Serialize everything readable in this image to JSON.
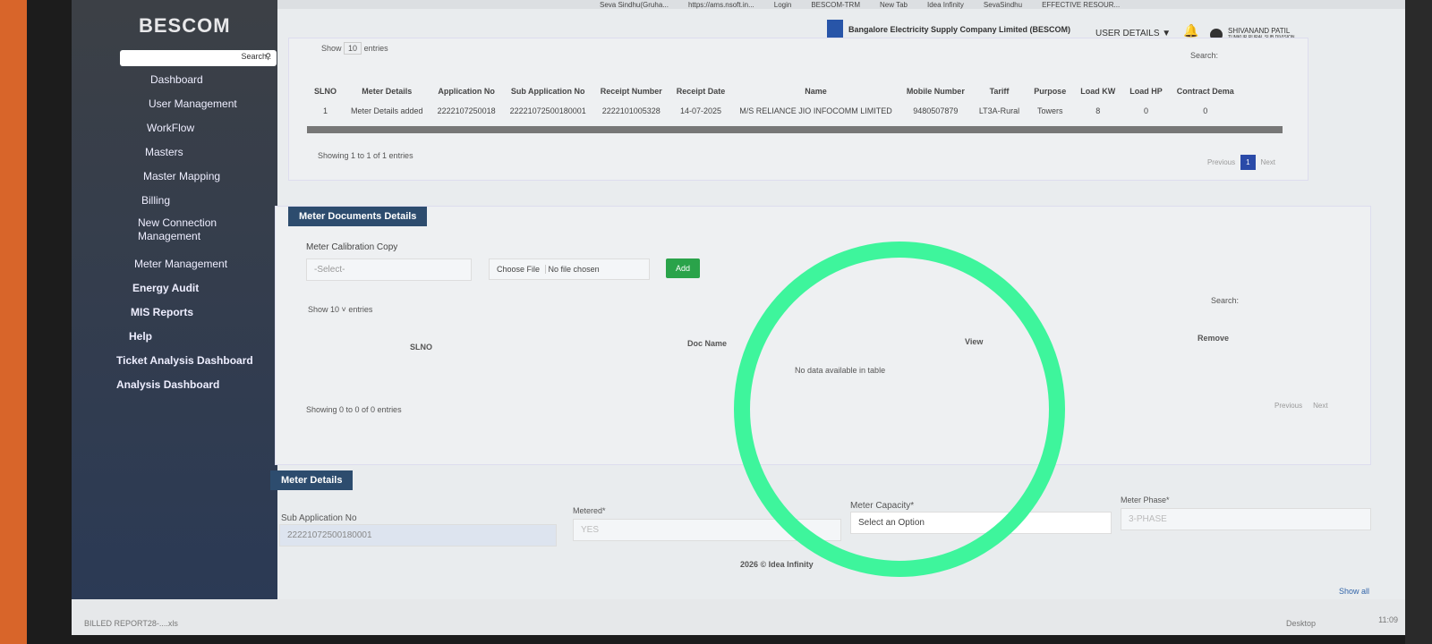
{
  "bookmarks": [
    "Seva Sindhu(Gruha...",
    "https://ams.nsoft.in...",
    "Login",
    "BESCOM-TRM",
    "New Tab",
    "Idea Infinity",
    "SevaSindhu",
    "EFFECTIVE RESOUR..."
  ],
  "sidebar": {
    "brand": "BESCOM",
    "search_placeholder": "Search..",
    "items": [
      "Dashboard",
      "User Management",
      "WorkFlow",
      "Masters",
      "Master Mapping",
      "Billing",
      "New Connection Management",
      "Meter Management",
      "Energy Audit",
      "MIS Reports",
      "Help",
      "Ticket Analysis Dashboard",
      "Analysis Dashboard"
    ]
  },
  "header": {
    "company": "Bangalore Electricity Supply Company Limited (BESCOM)",
    "user_details": "USER DETAILS",
    "user_name": "SHIVANAND PATIL",
    "user_division": "TUMKUR RURAL SUB DIVISION"
  },
  "table1": {
    "show": "Show",
    "entries_count": "10",
    "entries": "entries",
    "search": "Search:",
    "columns": [
      "SLNO",
      "Meter Details",
      "Application No",
      "Sub Application No",
      "Receipt Number",
      "Receipt Date",
      "Name",
      "Mobile Number",
      "Tariff",
      "Purpose",
      "Load KW",
      "Load HP",
      "Contract Dema"
    ],
    "rows": [
      [
        "1",
        "Meter Details added",
        "2222107250018",
        "22221072500180001",
        "2222101005328",
        "14-07-2025",
        "M/S RELIANCE JIO INFOCOMM LIMITED",
        "9480507879",
        "LT3A-Rural",
        "Towers",
        "8",
        "0",
        "0"
      ]
    ],
    "info": "Showing 1 to 1 of 1 entries",
    "prev": "Previous",
    "page": "1",
    "next": "Next"
  },
  "docs": {
    "title": "Meter Documents Details",
    "calib_label": "Meter Calibration Copy",
    "select": "-Select-",
    "choose_file": "Choose File",
    "no_file": "No file chosen",
    "add": "Add",
    "show": "Show",
    "entries_count": "10",
    "entries": "entries",
    "search": "Search:",
    "columns": [
      "SLNO",
      "Doc Name",
      "View",
      "Remove"
    ],
    "empty": "No data available in table",
    "info": "Showing 0 to 0 of 0 entries",
    "prev": "Previous",
    "next": "Next"
  },
  "meter": {
    "title": "Meter Details",
    "sub_app_label": "Sub Application No",
    "sub_app_value": "22221072500180001",
    "metered_label": "Metered*",
    "metered_value": "YES",
    "capacity_label": "Meter Capacity*",
    "capacity_value": "Select an Option",
    "phase_label": "Meter Phase*",
    "phase_value": "3-PHASE"
  },
  "footer": "2026 © Idea Infinity",
  "taskbar": {
    "download": "BILLED REPORT28-....xls",
    "show_all": "Show all",
    "desktop": "Desktop",
    "time": "11:09"
  }
}
